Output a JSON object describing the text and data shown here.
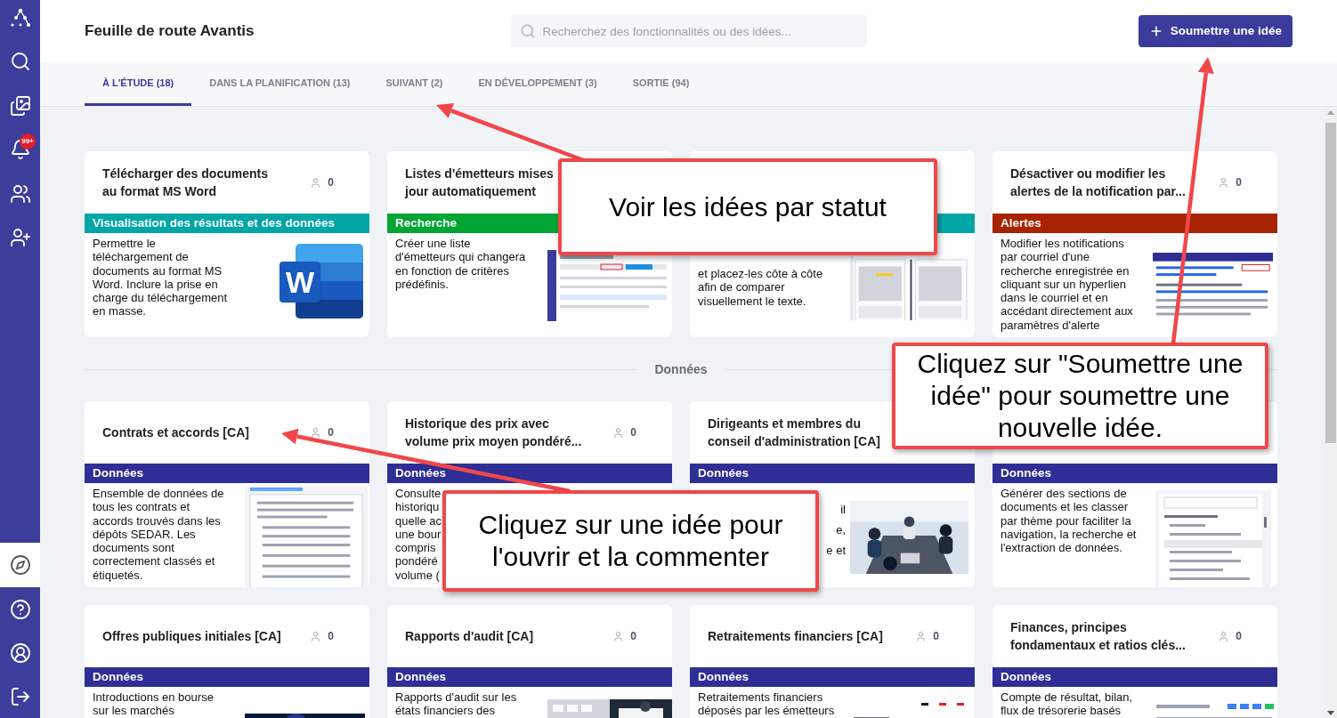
{
  "sidebar": {
    "top": [
      {
        "selected": false
      },
      {
        "selected": false
      },
      {
        "selected": false
      },
      {
        "selected": false,
        "badge": "99+"
      },
      {
        "selected": false
      },
      {
        "selected": false
      }
    ],
    "bottom": [
      {
        "selected": true
      },
      {
        "selected": false
      },
      {
        "selected": false
      },
      {
        "selected": false
      }
    ]
  },
  "header": {
    "title": "Feuille de route Avantis",
    "search": {
      "placeholder": "Recherchez des fonctionnalités ou des idées..."
    },
    "submit_button": "Soumettre une idée"
  },
  "tabs": [
    {
      "label": "À L'ÉTUDE (18)",
      "selected": true
    },
    {
      "label": "DANS LA PLANIFICATION (13)",
      "selected": false
    },
    {
      "label": "SUIVANT (2)",
      "selected": false
    },
    {
      "label": "EN DÉVELOPPEMENT (3)",
      "selected": false
    },
    {
      "label": "SORTIE (94)",
      "selected": false
    }
  ],
  "sections": [
    {
      "cards": [
        {
          "kind": "plain",
          "title_lines": [
            "Télécharger des documents",
            "au format MS Word"
          ],
          "count": "0",
          "tag": {
            "label": "Visualisation des résultats et des données",
            "color": "#00a6a6"
          },
          "description_lines": [
            "Permettre le",
            "téléchargement de",
            "documents au format MS",
            "Word. Inclure la prise en",
            "charge du téléchargement",
            "en masse."
          ],
          "media": {
            "kind": "logo",
            "letter": "W"
          }
        },
        {
          "kind": "plain",
          "title_lines": [
            "Listes d'émetteurs mises",
            "jour automatiquement"
          ],
          "tag": {
            "label": "Recherche",
            "color": "#00a534"
          },
          "description_lines": [
            "Créer une liste",
            "d'émetteurs qui changera",
            "en fonction de critères",
            "prédéfinis."
          ],
          "media": {
            "kind": "picture"
          }
        },
        {
          "kind": "pushed",
          "tag": {
            "color": "#00a6a6"
          },
          "description_lines": [
            "et placez-les côte à côte",
            "afin de comparer",
            "visuellement le texte."
          ],
          "media": {
            "kind": "picture"
          }
        },
        {
          "kind": "plain",
          "title_lines": [
            "Désactiver ou modifier les",
            "alertes de la notification par..."
          ],
          "count": "0",
          "tag": {
            "label": "Alertes",
            "color": "#a82400"
          },
          "description_lines": [
            "Modifier les notifications",
            "par courriel d'une",
            "recherche enregistrée en",
            "cliquant sur un hyperlien",
            "dans le courriel et en",
            "accédant directement aux",
            "paramètres d'alerte"
          ],
          "media": {
            "kind": "picture"
          }
        }
      ]
    },
    {
      "heading": "Données",
      "cards": [
        {
          "kind": "plain",
          "title_lines": [
            "Contrats et accords [CA]"
          ],
          "count": "0",
          "tag": {
            "label": "Données",
            "color": "#2e2e96"
          },
          "description_lines": [
            "Ensemble de données de",
            "tous les contrats et",
            "accords trouvés dans les",
            "dépôts SEDAR. Les",
            "documents sont",
            "correctement classés et",
            "étiquetés."
          ],
          "media": {
            "kind": "picture"
          }
        },
        {
          "kind": "plain",
          "title_lines": [
            "Historique des prix avec",
            "volume prix moyen pondéré..."
          ],
          "count": "0",
          "tag": {
            "label": "Données",
            "color": "#2e2e96"
          },
          "description_lines": [
            "Consulte",
            "historiqu",
            "quelle ac",
            "une bour",
            "compris",
            "pondéré",
            "volume ("
          ]
        },
        {
          "kind": "right_fragments",
          "title_lines": [
            "Dirigeants et membres du",
            "conseil d'administration [CA]"
          ],
          "tag": {
            "label": "Données",
            "color": "#2e2e96"
          },
          "description_lines": [
            "il",
            "e,",
            "e et"
          ],
          "media": {
            "kind": "picture"
          }
        },
        {
          "kind": "plain",
          "tag": {
            "label": "Données",
            "color": "#2e2e96"
          },
          "description_lines": [
            "Générer des sections de",
            "documents et les classer",
            "par thème pour faciliter la",
            "navigation, la recherche et",
            "l'extraction de données."
          ],
          "media": {
            "kind": "picture"
          }
        },
        {
          "kind": "plain",
          "title_lines": [
            "Offres publiques initiales [CA]"
          ],
          "count": "0",
          "tag": {
            "label": "Données",
            "color": "#2e2e96"
          },
          "description_lines": [
            "Introductions en bourse",
            "sur les marchés"
          ],
          "media": {
            "kind": "picture"
          }
        },
        {
          "kind": "plain",
          "title_lines": [
            "Rapports d'audit [CA]"
          ],
          "count": "0",
          "tag": {
            "label": "Données",
            "color": "#2e2e96"
          },
          "description_lines": [
            "Rapports d'audit sur les",
            "états financiers des"
          ],
          "media": {
            "kind": "picture"
          }
        },
        {
          "kind": "plain",
          "title_lines": [
            "Retraitements financiers [CA]"
          ],
          "count": "0",
          "tag": {
            "label": "Données",
            "color": "#2e2e96"
          },
          "description_lines": [
            "Retraitements financiers",
            "déposés par les émetteurs"
          ],
          "media": {
            "kind": "picture"
          }
        },
        {
          "kind": "plain",
          "title_lines": [
            "Finances, principes",
            "fondamentaux et ratios clés..."
          ],
          "count": "0",
          "tag": {
            "label": "Données",
            "color": "#2e2e96"
          },
          "description_lines": [
            "Compte de résultat, bilan,",
            "flux de trésorerie basés"
          ],
          "media": {
            "kind": "picture"
          }
        }
      ]
    }
  ],
  "callouts": [
    {
      "text_lines": [
        "Voir les idées par statut"
      ]
    },
    {
      "text_lines": [
        "Cliquez sur \"Soumettre une",
        "idée\" pour soumettre une",
        "nouvelle idée."
      ]
    },
    {
      "text_lines": [
        "Cliquez sur une idée pour",
        "l'ouvrir et la commenter"
      ]
    }
  ]
}
